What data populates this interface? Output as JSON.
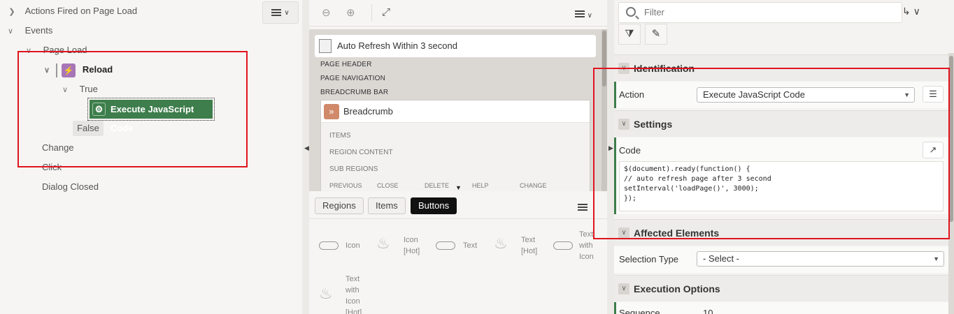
{
  "tree": {
    "actions_fired": "Actions Fired on Page Load",
    "events": "Events",
    "page_load": "Page Load",
    "reload": "Reload",
    "true_branch": "True",
    "execute_js": "Execute JavaScript Code",
    "false_branch": "False",
    "change": "Change",
    "click": "Click",
    "dialog_closed": "Dialog Closed"
  },
  "layout": {
    "page_title": "Auto Refresh Within 3 second",
    "page_header": "PAGE HEADER",
    "page_navigation": "PAGE NAVIGATION",
    "breadcrumb_bar": "BREADCRUMB BAR",
    "breadcrumb": "Breadcrumb",
    "items": "ITEMS",
    "region_content": "REGION CONTENT",
    "sub_regions": "SUB REGIONS",
    "buttons": [
      "PREVIOUS",
      "CLOSE",
      "DELETE",
      "HELP",
      "CHANGE"
    ]
  },
  "gallery": {
    "tabs": [
      "Regions",
      "Items",
      "Buttons"
    ],
    "active_tab": "Buttons",
    "items": {
      "icon": "Icon",
      "icon_hot": "Icon [Hot]",
      "text": "Text",
      "text_hot": "Text [Hot]",
      "text_with_icon": "Text with Icon",
      "text_with_icon_hot": "Text with Icon [Hot]"
    }
  },
  "props": {
    "filter_placeholder": "Filter",
    "identification": "Identification",
    "action_label": "Action",
    "action_value": "Execute JavaScript Code",
    "settings": "Settings",
    "code_label": "Code",
    "code_value": "$(document).ready(function() {\n// auto refresh page after 3 second\nsetInterval('loadPage()', 3000);\n});",
    "affected_elements": "Affected Elements",
    "selection_type_label": "Selection Type",
    "selection_type_value": "- Select -",
    "execution_options": "Execution Options",
    "sequence_label": "Sequence",
    "sequence_value": "10"
  },
  "colors": {
    "highlight": "#e0141f",
    "execute_node": "#3e7d4c",
    "active_tab": "#111111"
  }
}
